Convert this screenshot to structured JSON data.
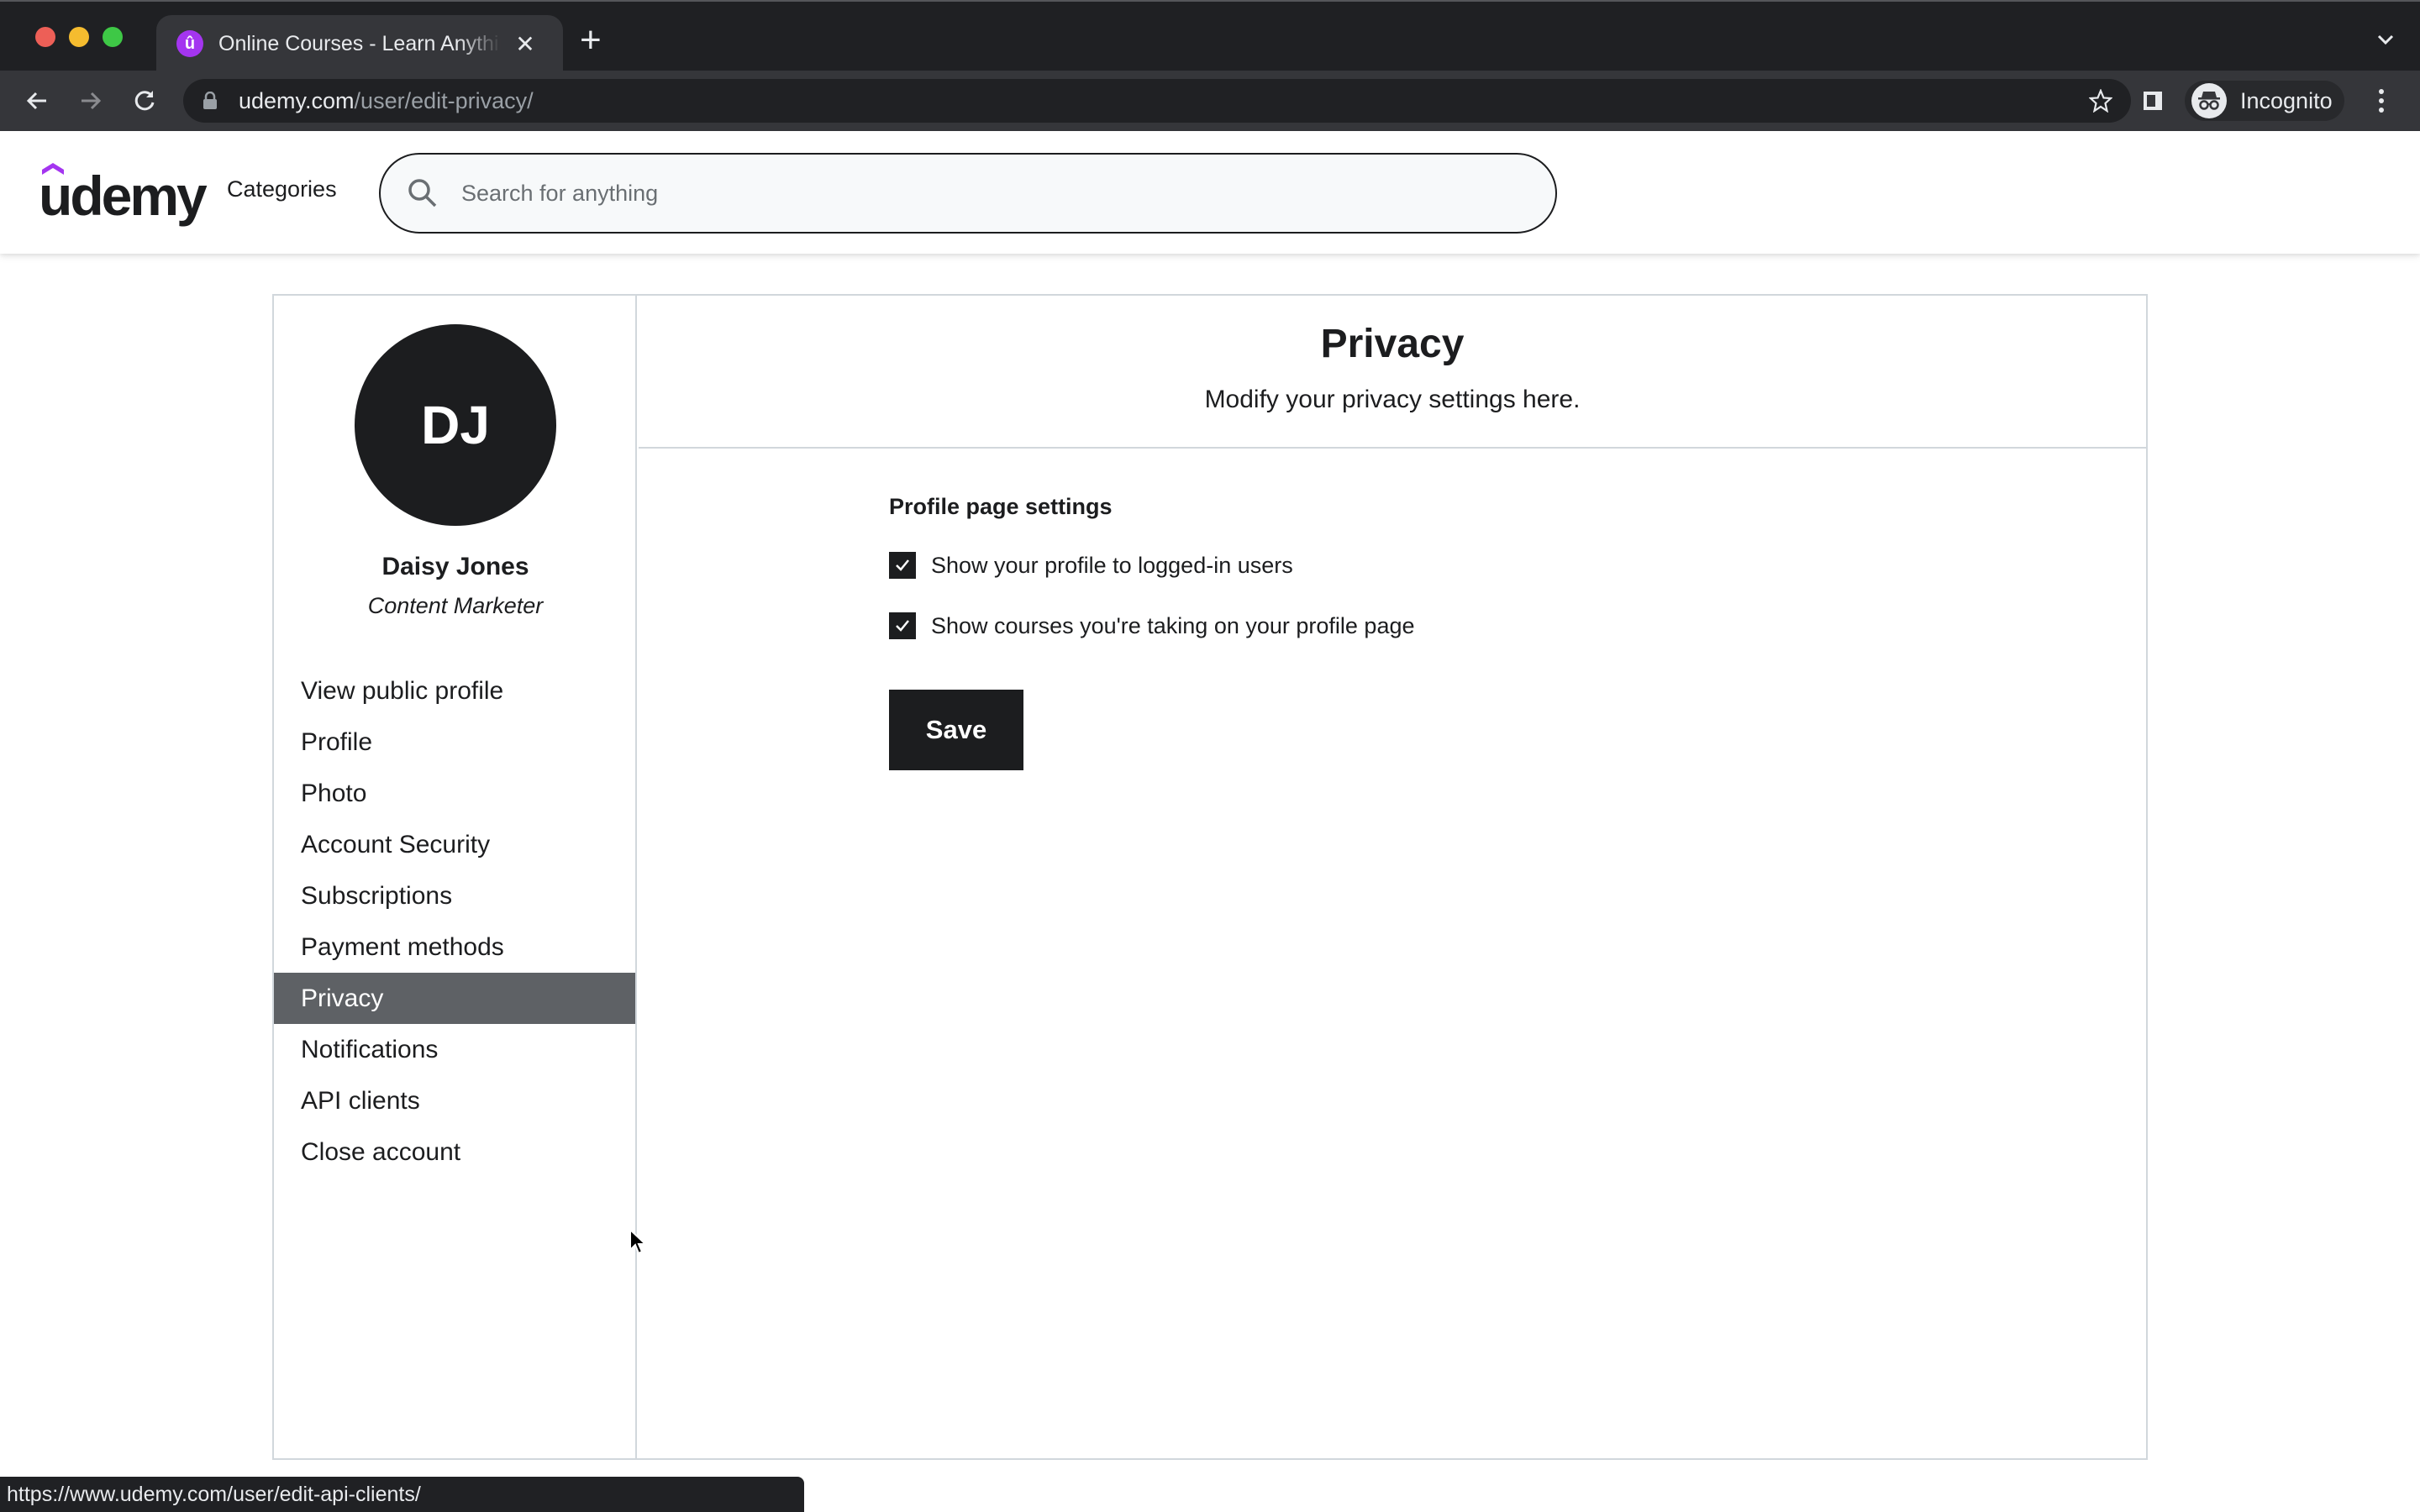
{
  "browser": {
    "tab_title": "Online Courses - Learn Anything, On Your Schedule | Udemy",
    "new_tab_label": "+",
    "url_domain": "udemy.com",
    "url_path": "/user/edit-privacy/",
    "incognito_label": "Incognito",
    "status_url": "https://www.udemy.com/user/edit-api-clients/"
  },
  "header": {
    "logo_text": "udemy",
    "categories_label": "Categories",
    "search_placeholder": "Search for anything",
    "brand_color": "#a435f0"
  },
  "profile": {
    "initials": "DJ",
    "name": "Daisy Jones",
    "headline": "Content Marketer"
  },
  "sidebar": {
    "items": [
      {
        "label": "View public profile",
        "active": false
      },
      {
        "label": "Profile",
        "active": false
      },
      {
        "label": "Photo",
        "active": false
      },
      {
        "label": "Account Security",
        "active": false
      },
      {
        "label": "Subscriptions",
        "active": false
      },
      {
        "label": "Payment methods",
        "active": false
      },
      {
        "label": "Privacy",
        "active": true
      },
      {
        "label": "Notifications",
        "active": false
      },
      {
        "label": "API clients",
        "active": false
      },
      {
        "label": "Close account",
        "active": false
      }
    ]
  },
  "main": {
    "title": "Privacy",
    "subtitle": "Modify your privacy settings here.",
    "section_title": "Profile page settings",
    "options": [
      {
        "label": "Show your profile to logged-in users",
        "checked": true
      },
      {
        "label": "Show courses you're taking on your profile page",
        "checked": true
      }
    ],
    "save_label": "Save"
  }
}
